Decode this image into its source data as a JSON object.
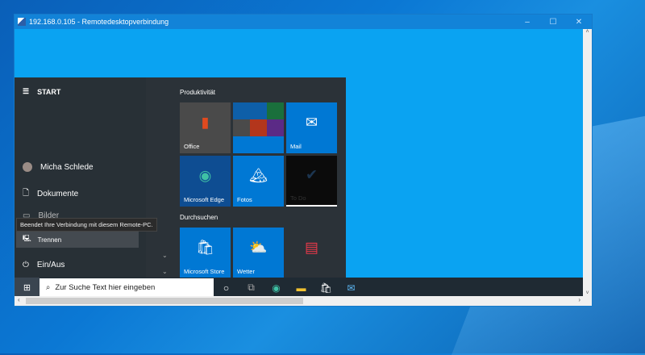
{
  "window": {
    "title": "192.168.0.105 - Remotedesktopverbindung",
    "minimize": "–",
    "maximize": "☐",
    "close": "✕"
  },
  "start": {
    "header": "START",
    "user": "Micha Schlede",
    "items": [
      "Dokumente",
      "Bilder"
    ],
    "power": "Ein/Aus",
    "tooltip": "Beendet Ihre Verbindung mit diesem Remote-PC.",
    "disconnect": "Trennen"
  },
  "groups": [
    "Produktivität",
    "Durchsuchen"
  ],
  "tiles": [
    "Office",
    "Mail",
    "Microsoft Edge",
    "Fotos",
    "To Do",
    "Microsoft Store",
    "Wetter"
  ],
  "taskbar": {
    "search_placeholder": "Zur Suche Text hier eingeben"
  },
  "colors": {
    "tile_blue": "#0078d4",
    "accent": "#1283d8"
  }
}
